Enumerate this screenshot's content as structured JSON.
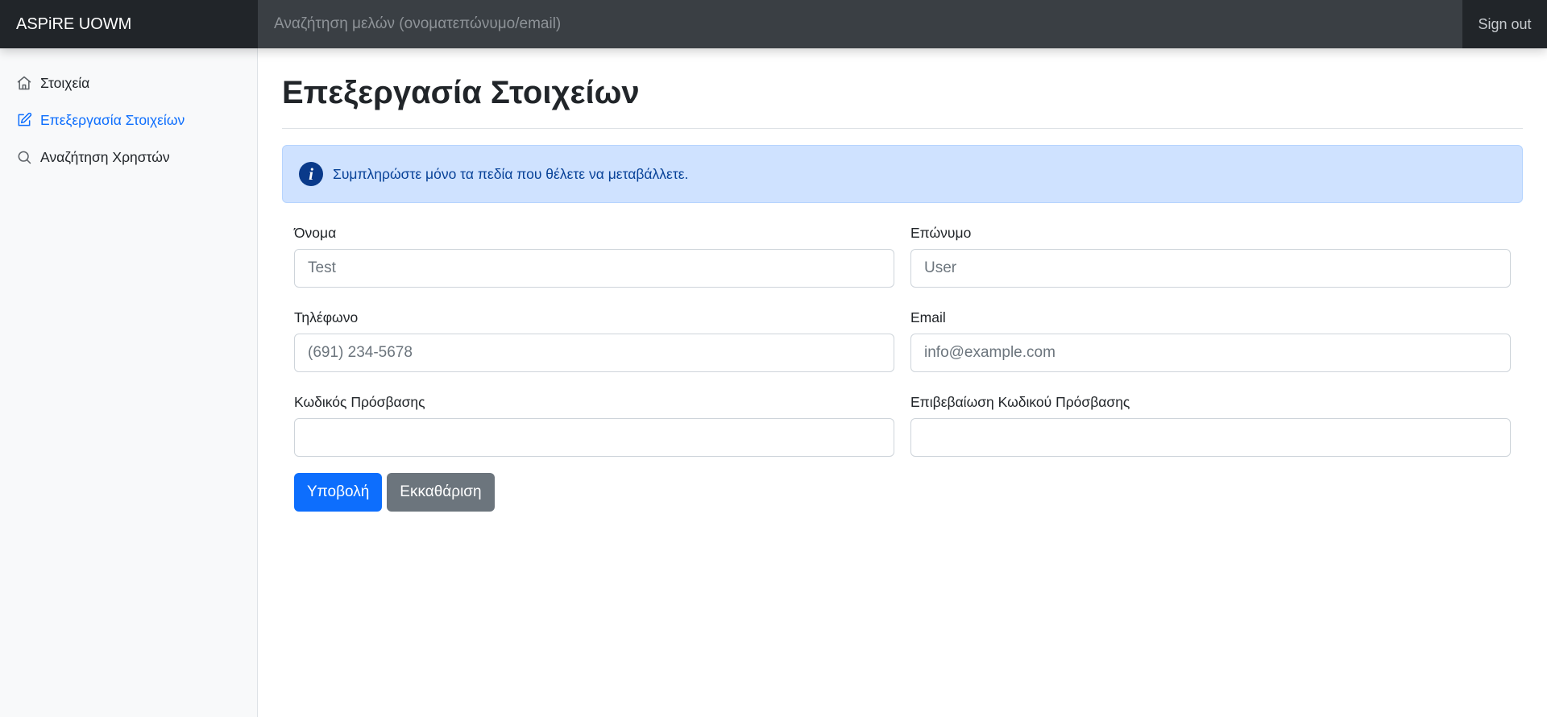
{
  "header": {
    "brand": "ASPiRE UOWM",
    "search_placeholder": "Αναζήτηση μελών (ονοματεπώνυμο/email)",
    "sign_out": "Sign out"
  },
  "sidebar": {
    "items": [
      {
        "label": "Στοιχεία",
        "icon": "home-icon",
        "active": false
      },
      {
        "label": "Επεξεργασία Στοιχείων",
        "icon": "edit-icon",
        "active": true
      },
      {
        "label": "Αναζήτηση Χρηστών",
        "icon": "search-icon",
        "active": false
      }
    ]
  },
  "main": {
    "title": "Επεξεργασία Στοιχείων",
    "alert": {
      "icon": "info-icon",
      "text": "Συμπληρώστε μόνο τα πεδία που θέλετε να μεταβάλλετε."
    },
    "form": {
      "first_name": {
        "label": "Όνομα",
        "placeholder": "Test",
        "value": ""
      },
      "last_name": {
        "label": "Επώνυμο",
        "placeholder": "User",
        "value": ""
      },
      "phone": {
        "label": "Τηλέφωνο",
        "placeholder": "(691) 234-5678",
        "value": ""
      },
      "email": {
        "label": "Email",
        "placeholder": "info@example.com",
        "value": ""
      },
      "password": {
        "label": "Κωδικός Πρόσβασης",
        "placeholder": "",
        "value": ""
      },
      "password_confirm": {
        "label": "Επιβεβαίωση Κωδικού Πρόσβασης",
        "placeholder": "",
        "value": ""
      },
      "submit_label": "Υποβολή",
      "clear_label": "Εκκαθάριση"
    }
  },
  "colors": {
    "primary": "#0d6efd",
    "secondary": "#6c757d",
    "topbar": "#343a40",
    "alert_bg": "#cfe2ff",
    "alert_text": "#084298"
  }
}
